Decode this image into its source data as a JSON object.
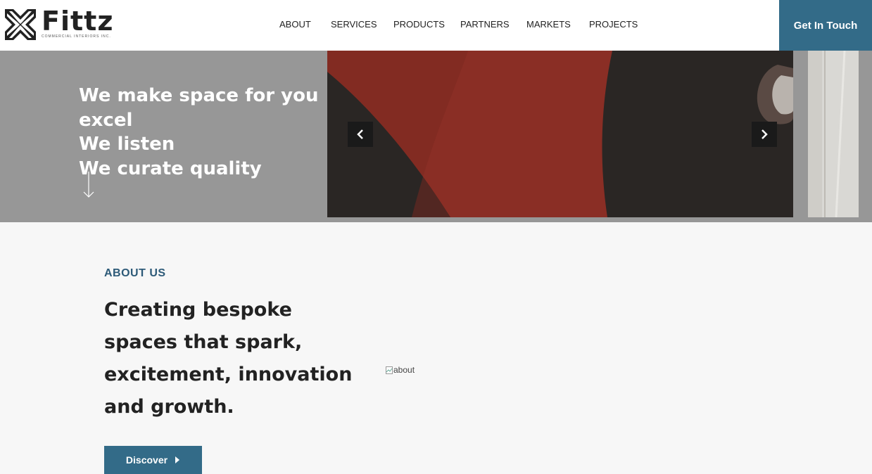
{
  "header": {
    "logo": {
      "name": "Fittz",
      "tagline": "COMMERCIAL INTERIORS INC."
    },
    "nav": [
      {
        "label": "ABOUT"
      },
      {
        "label": "SERVICES"
      },
      {
        "label": "PRODUCTS"
      },
      {
        "label": "PARTNERS"
      },
      {
        "label": "MARKETS"
      },
      {
        "label": "PROJECTS"
      }
    ],
    "cta_label": "Get In Touch"
  },
  "hero": {
    "lines": [
      "We make space for you",
      "excel",
      "We listen",
      "We curate quality"
    ],
    "icons": {
      "scroll": "arrow-down-icon",
      "prev": "chevron-left-icon",
      "next": "chevron-right-icon"
    }
  },
  "about": {
    "kicker": "ABOUT US",
    "heading_lines": [
      "Creating bespoke",
      "spaces that spark,",
      "excitement, innovation",
      "and growth."
    ],
    "image_alt": "about",
    "discover_label": "Discover"
  },
  "colors": {
    "accent": "#336b88",
    "kicker": "#2d5a78",
    "hero_bg": "#979797"
  }
}
